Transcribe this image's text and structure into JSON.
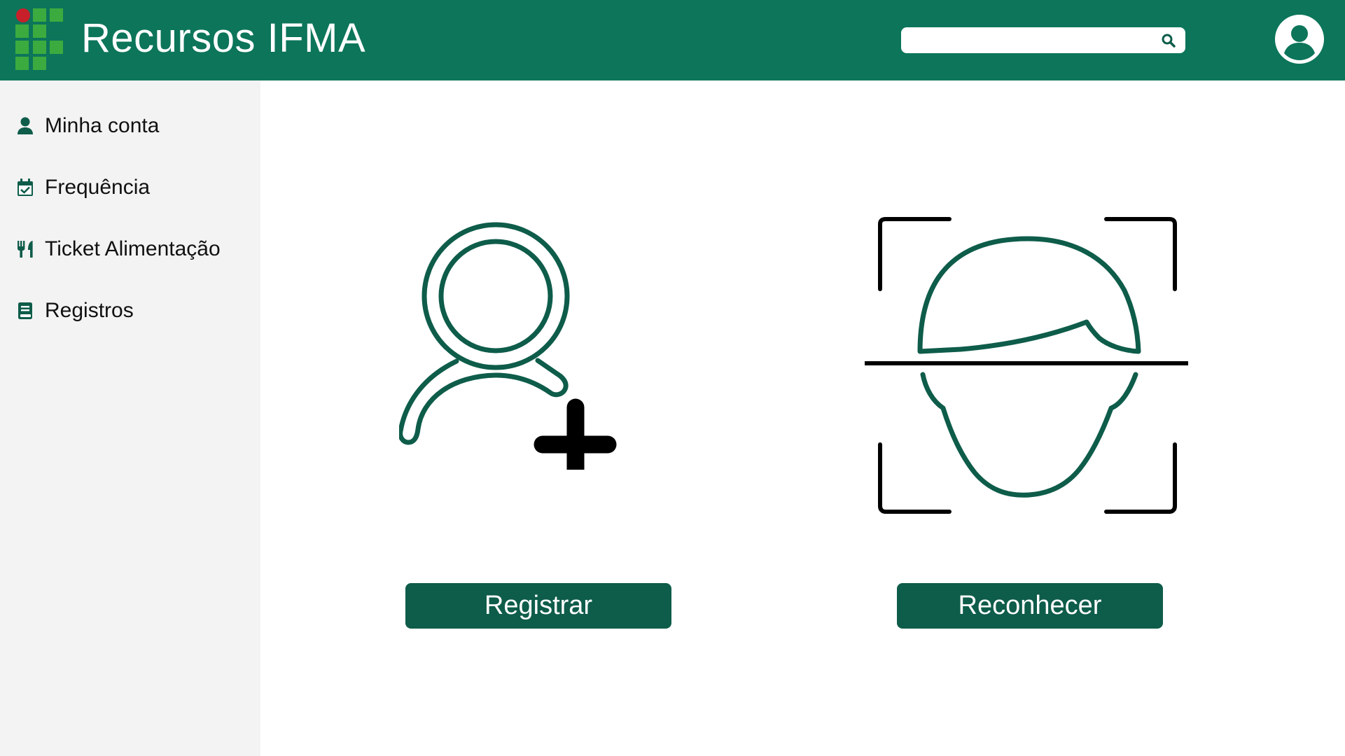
{
  "header": {
    "title": "Recursos IFMA",
    "search": {
      "value": "",
      "placeholder": ""
    },
    "logo_icon": "ifma-logo",
    "avatar_icon": "user-circle-icon"
  },
  "sidebar": {
    "items": [
      {
        "label": "Minha conta",
        "icon": "user-icon"
      },
      {
        "label": "Frequência",
        "icon": "calendar-check-icon"
      },
      {
        "label": "Ticket Alimentação",
        "icon": "utensils-icon"
      },
      {
        "label": "Registros",
        "icon": "book-icon"
      }
    ]
  },
  "main": {
    "actions": [
      {
        "label": "Registrar",
        "icon": "add-user-icon"
      },
      {
        "label": "Reconhecer",
        "icon": "face-recognition-icon"
      }
    ]
  },
  "colors": {
    "header_bg": "#0c755a",
    "button_bg": "#0e5c4a",
    "sidebar_bg": "#f3f3f3",
    "logo_green": "#3cab3f",
    "logo_red": "#c8202a",
    "icon_green": "#0e5c4a"
  }
}
